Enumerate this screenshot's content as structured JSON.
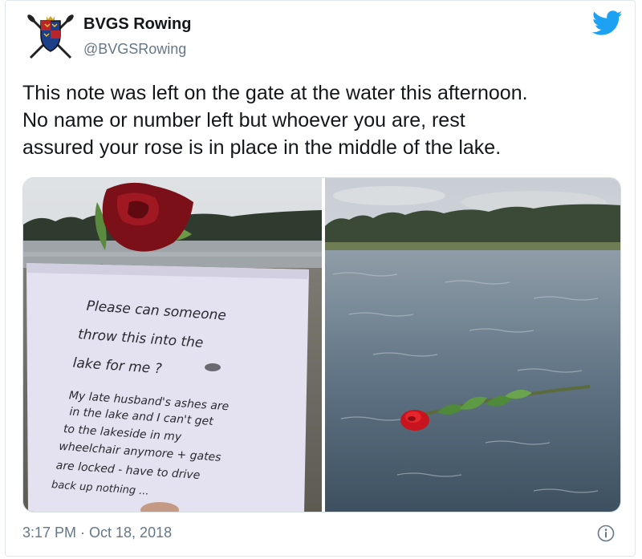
{
  "author": {
    "name": "BVGS Rowing",
    "handle": "@BVGSRowing"
  },
  "brand": {
    "twitter_blue": "#1da1f2",
    "text_dark": "#14171a",
    "text_muted": "#657786"
  },
  "tweet": {
    "text_lines": [
      "This note was left on the gate at the water this afternoon.",
      "No name or number left but whoever you are, rest",
      "assured your rose is in place in the middle of the lake."
    ],
    "timestamp": "3:17 PM · Oct 18, 2018"
  },
  "note": {
    "lines": [
      "Please   can someone",
      "throw this into the",
      "lake for me ?",
      "My late husband's ashes are",
      "in the lake and I can't get",
      "to the lakeside in my",
      "wheelchair anymore + gates",
      "are locked - have to drive",
      "back up nothing ..."
    ]
  },
  "icons": {
    "avatar": "crest-with-crossed-oars",
    "logo": "twitter-bird-icon",
    "info": "info-icon"
  }
}
